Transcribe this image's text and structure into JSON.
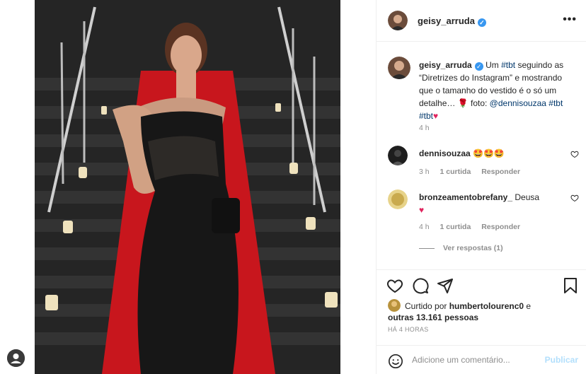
{
  "post": {
    "author": "geisy_arruda",
    "more_label": "•••"
  },
  "caption": {
    "author": "geisy_arruda",
    "text_1": "Um",
    "tag_1": "#tbt",
    "text_2": "seguindo as “Diretrizes do Instagram” e mostrando que o tamanho do vestido é o só um detalhe… 🌹 foto:",
    "mention": "@dennisouzaa",
    "tag_2": "#tbt",
    "tag_3": "#tbt",
    "time": "4 h"
  },
  "comments": [
    {
      "user": "dennisouzaa",
      "text": "🤩🤩🤩",
      "time": "3 h",
      "likes": "1 curtida",
      "reply": "Responder"
    },
    {
      "user": "bronzeamentobrefany_",
      "text": "Deusa",
      "time": "4 h",
      "likes": "1 curtida",
      "reply": "Responder"
    }
  ],
  "view_replies": "Ver respostas (1)",
  "likes": {
    "prefix": "Curtido por",
    "user": "humbertolourenc0",
    "connector": "e",
    "others": "outras 13.161 pessoas"
  },
  "ago": "HÁ 4 HORAS",
  "add_comment": {
    "placeholder": "Adicione um comentário...",
    "publish": "Publicar"
  },
  "colors": {
    "verified": "#3897f0",
    "link": "#00376b",
    "heart": "#e0245e",
    "carpet": "#c8161d"
  },
  "icons": [
    "verified-icon",
    "more-icon",
    "heart-icon",
    "comment-icon",
    "share-icon",
    "bookmark-icon",
    "emoji-icon",
    "user-icon"
  ]
}
